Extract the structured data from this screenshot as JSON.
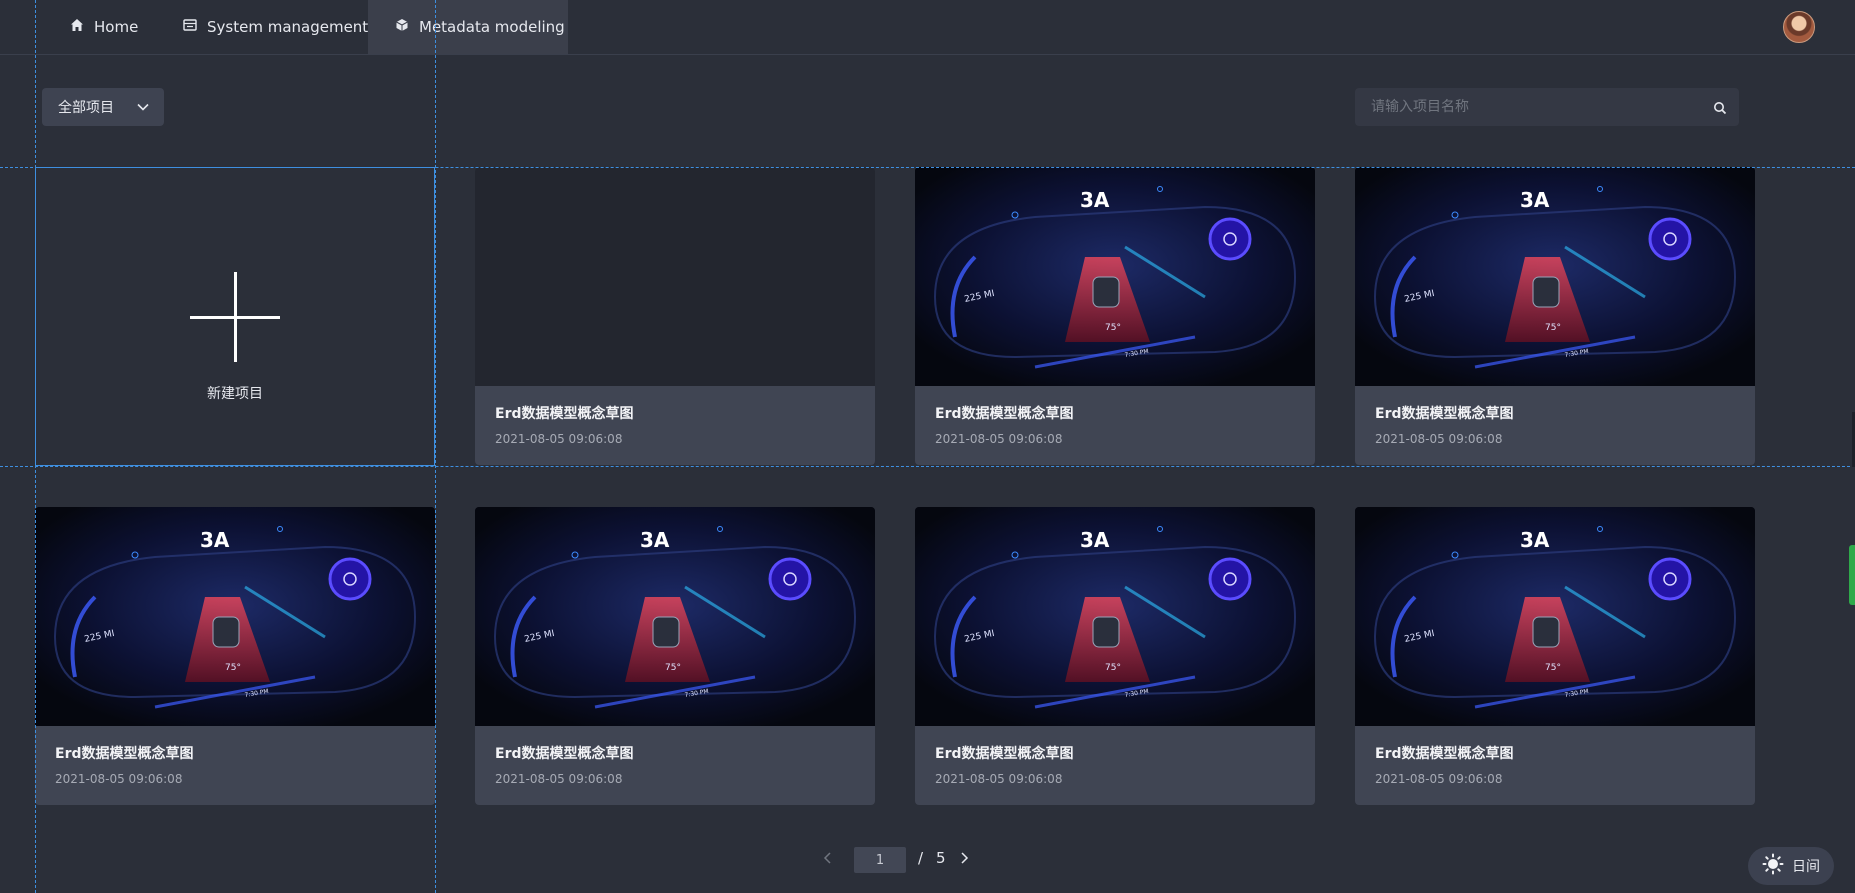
{
  "nav": {
    "home": "Home",
    "system": "System management",
    "metadata": "Metadata modeling"
  },
  "filter": {
    "dropdown_value": "全部项目",
    "search_placeholder": "请输入项目名称"
  },
  "new_project_label": "新建项目",
  "cards": [
    {
      "title": "Erd数据模型概念草图",
      "date": "2021-08-05 09:06:08"
    },
    {
      "title": "Erd数据模型概念草图",
      "date": "2021-08-05 09:06:08"
    },
    {
      "title": "Erd数据模型概念草图",
      "date": "2021-08-05 09:06:08"
    },
    {
      "title": "Erd数据模型概念草图",
      "date": "2021-08-05 09:06:08"
    },
    {
      "title": "Erd数据模型概念草图",
      "date": "2021-08-05 09:06:08"
    },
    {
      "title": "Erd数据模型概念草图",
      "date": "2021-08-05 09:06:08"
    },
    {
      "title": "Erd数据模型概念草图",
      "date": "2021-08-05 09:06:08"
    }
  ],
  "thumbnail": {
    "brand": "3A",
    "range": "225 MI",
    "temp": "75°",
    "time": "7:30 PM"
  },
  "pagination": {
    "current": "1",
    "separator": "/",
    "total": "5"
  },
  "theme_toggle_label": "日间",
  "colors": {
    "background": "#2b2f39",
    "card": "#404553",
    "accent_guide": "#3e8fe0"
  }
}
